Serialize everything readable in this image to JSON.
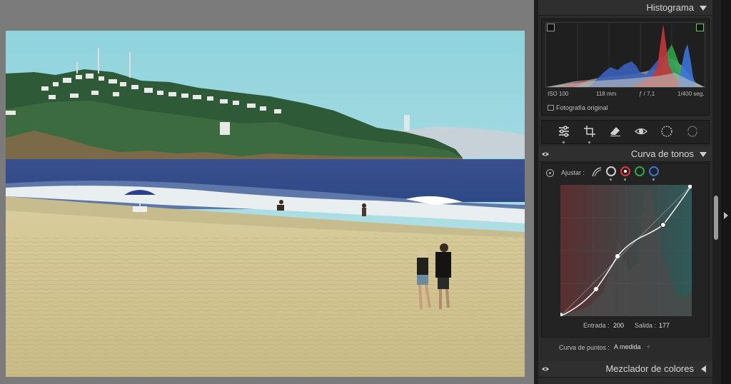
{
  "histogram": {
    "title": "Histograma",
    "iso": "ISO 100",
    "focal": "118 mm",
    "aperture": "ƒ / 7,1",
    "shutter": "1/400 seg.",
    "original_label": "Fotografía original"
  },
  "toolbar": {
    "icons": [
      "sliders-icon",
      "crop-icon",
      "eraser-icon",
      "redeye-icon",
      "mask-icon",
      "transform-icon"
    ]
  },
  "tone_curve": {
    "title": "Curva de tonos",
    "adjust_label": "Ajustar :",
    "input_label": "Entrada :",
    "input_value": "200",
    "output_label": "Salida :",
    "output_value": "177",
    "points_label": "Curva de puntos :",
    "points_value": "A medida",
    "points_arrow": "÷"
  },
  "color_mixer": {
    "title": "Mezclador de colores"
  },
  "colors": {
    "channel_white": "#d0d0d0",
    "channel_red": "#e0333a",
    "channel_green": "#2fa84a",
    "channel_blue": "#3a74d8"
  }
}
